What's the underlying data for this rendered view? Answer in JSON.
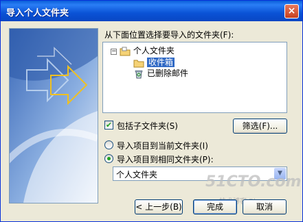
{
  "window": {
    "title": "导入个人文件夹",
    "close_glyph": "×"
  },
  "instruction": "从下面位置选择要导入的文件夹(F):",
  "tree": {
    "expander": "−",
    "items": [
      {
        "label": "个人文件夹",
        "icon": "folder-personal-icon",
        "selected": false
      },
      {
        "label": "收件箱",
        "icon": "folder-inbox-icon",
        "selected": true
      },
      {
        "label": "已删除邮件",
        "icon": "recycle-bin-icon",
        "selected": false
      }
    ]
  },
  "include_subfolders": {
    "label": "包括子文件夹(S)",
    "checked": true,
    "check_glyph": "✔"
  },
  "filter_button": "筛选(F)...",
  "radio_current": {
    "label": "导入项目到当前文件夹(I)",
    "selected": false
  },
  "radio_same": {
    "label": "导入项目到相同文件夹(P):",
    "selected": true
  },
  "target_folder": {
    "value": "个人文件夹",
    "arrow_glyph": "▼"
  },
  "buttons": {
    "back": "< 上一步(B)",
    "finish": "完成",
    "cancel": "取消"
  },
  "watermark": {
    "main": "51CTO.com",
    "sub": "技术博客 Blog"
  },
  "colors": {
    "selection": "#316ac5",
    "title_bar": "#0a5ed8",
    "dialog_bg": "#ece9d8"
  }
}
